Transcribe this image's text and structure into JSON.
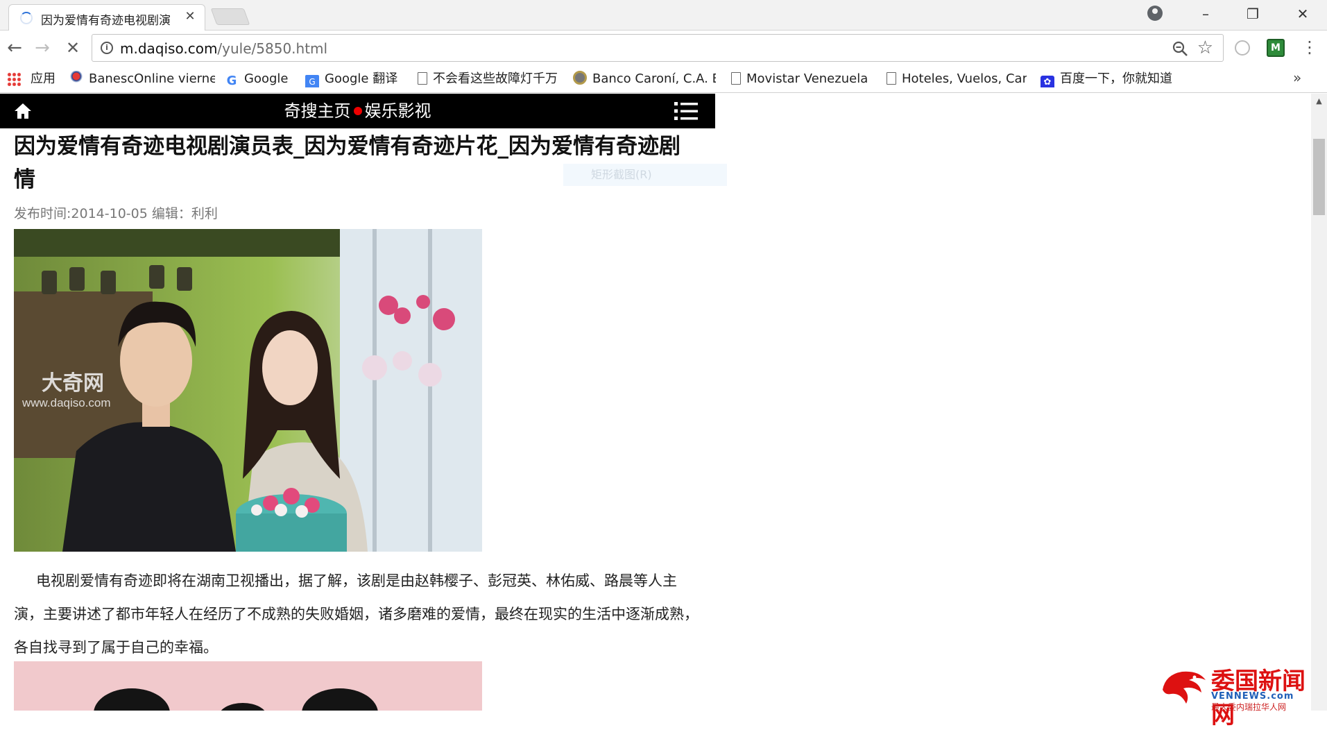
{
  "browser": {
    "tab_title": "因为爱情有奇迹电视剧演",
    "url_host": "m.daqiso.com",
    "url_path": "/yule/5850.html",
    "window_buttons": {
      "minimize": "–",
      "restore": "❐",
      "close": "✕"
    }
  },
  "bookmarks": [
    {
      "label": "应用",
      "icon": "apps-grid-icon"
    },
    {
      "label": "BanescOnline vierne",
      "icon": "banesco-icon"
    },
    {
      "label": "Google",
      "icon": "google-icon"
    },
    {
      "label": "Google 翻译",
      "icon": "translate-icon"
    },
    {
      "label": "不会看这些故障灯千万",
      "icon": "page-icon"
    },
    {
      "label": "Banco Caroní, C.A. B",
      "icon": "bank-icon"
    },
    {
      "label": "Movistar Venezuela",
      "icon": "page-icon"
    },
    {
      "label": "Hoteles, Vuelos, Car",
      "icon": "page-icon"
    },
    {
      "label": "百度一下，你就知道",
      "icon": "baidu-paw-icon"
    }
  ],
  "site": {
    "nav_left": "奇搜主页",
    "nav_right": "娱乐影视"
  },
  "article": {
    "title": "因为爱情有奇迹电视剧演员表_因为爱情有奇迹片花_因为爱情有奇迹剧情",
    "meta": "发布时间:2014-10-05 编辑：利利",
    "photo_watermark_title": "大奇网",
    "photo_watermark_url": "www.daqiso.com",
    "paragraph": "电视剧爱情有奇迹即将在湖南卫视播出，据了解，该剧是由赵韩樱子、彭冠英、林佑威、路晨等人主演，主要讲述了都市年轻人在经历了不成熟的失败婚姻，诸多磨难的爱情，最终在现实的生活中逐渐成熟，各自找寻到了属于自己的幸福。"
  },
  "ghost_menu": "矩形截图(R)",
  "watermark": {
    "title": "委国新闻网",
    "url": "VENNEWS.com",
    "subtitle": "最大委内瑞拉华人网"
  }
}
